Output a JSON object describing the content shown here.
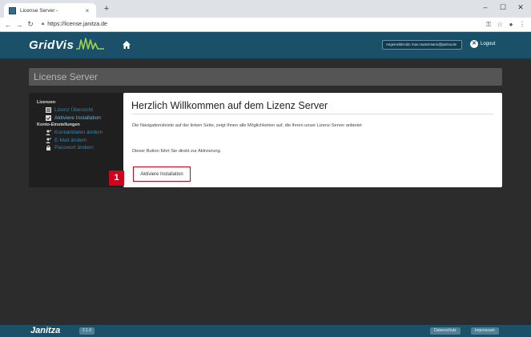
{
  "browser": {
    "tab_title": "License Server -",
    "tab_close": "×",
    "new_tab": "+",
    "url": "https://license.janitza.de",
    "window_controls": {
      "minimize": "–",
      "maximize": "☐",
      "close": "✕"
    }
  },
  "header": {
    "logo_text": "GridVis",
    "account_text": "Angemeldet als: max.mustermann@janitza.de",
    "logout_label": "Logout"
  },
  "page": {
    "title": "License Server"
  },
  "sidebar": {
    "section_licenses": "Lizenzen",
    "items_licenses": [
      {
        "label": "Lizenz Übersicht",
        "icon": "list-icon"
      },
      {
        "label": "Aktiviere Installation",
        "icon": "checkbox-icon"
      }
    ],
    "section_account": "Konto-Einstellungen",
    "items_account": [
      {
        "label": "Kontaktdaten ändern",
        "icon": "user-edit-icon"
      },
      {
        "label": "E-Mail ändern",
        "icon": "user-mail-icon"
      },
      {
        "label": "Passwort ändern",
        "icon": "lock-icon"
      }
    ]
  },
  "content": {
    "title": "Herzlich Willkommen auf dem Lizenz Server",
    "paragraph_1": "Die Navigationsleiste auf der linken Seite, zeigt Ihnen alle Möglichkeiten auf, die Ihnen unser Lizenz-Server anbietet",
    "paragraph_2": "Dieser Button führt Sie direkt zur Aktivierung.",
    "activate_button": "Aktiviere Installation"
  },
  "annotation": {
    "step_number": "1",
    "color": "#d0021b"
  },
  "footer": {
    "logo_text": "Janitza",
    "version": "2.1.0",
    "link_privacy": "Datenschutz",
    "link_imprint": "Impressum"
  },
  "colors": {
    "header_bg": "#1b5168",
    "page_bg": "#2c2c2c",
    "link": "#3a85a8"
  }
}
